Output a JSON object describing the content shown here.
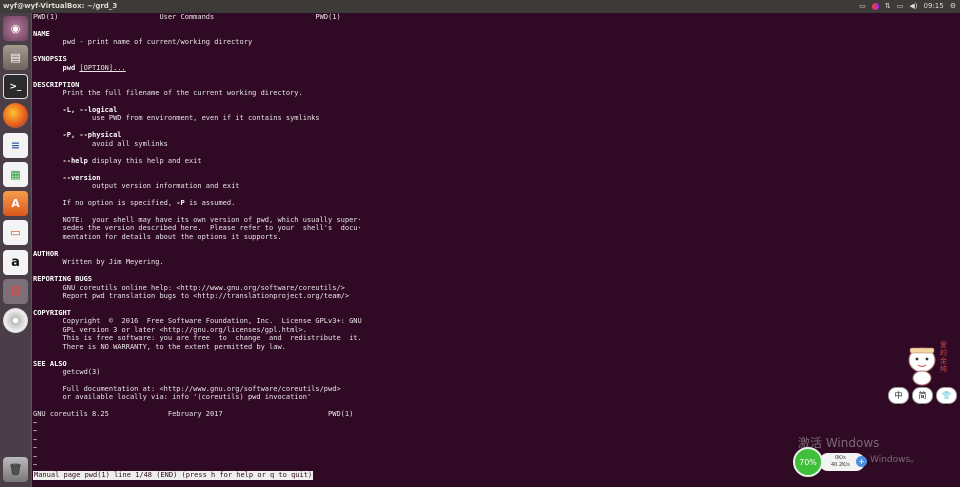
{
  "window": {
    "title": "wyf@wyf-VirtualBox: ~/grd_3"
  },
  "tray": {
    "time": "09:15",
    "icons": [
      "keyboard-icon",
      "color-app-icon",
      "network-icon",
      "battery-icon",
      "volume-icon",
      "gear-icon"
    ]
  },
  "launcher": {
    "items": [
      {
        "name": "ubuntu-dash-icon"
      },
      {
        "name": "file-manager-icon"
      },
      {
        "name": "terminal-icon"
      },
      {
        "name": "firefox-icon"
      },
      {
        "name": "writer-icon"
      },
      {
        "name": "calc-icon"
      },
      {
        "name": "software-center-icon"
      },
      {
        "name": "impress-icon"
      },
      {
        "name": "amazon-icon"
      },
      {
        "name": "settings-icon"
      },
      {
        "name": "disc-icon"
      },
      {
        "name": "trash-icon"
      }
    ]
  },
  "man": {
    "header_left": "PWD(1)",
    "header_center": "User Commands",
    "header_right": "PWD(1)",
    "name_heading": "NAME",
    "name_text": "pwd - print name of current/working directory",
    "synopsis_heading": "SYNOPSIS",
    "synopsis_cmd": "pwd",
    "synopsis_opt": "[OPTION]...",
    "description_heading": "DESCRIPTION",
    "description_text": "Print the full filename of the current working directory.",
    "opt1": "-L, --logical",
    "opt1_desc": "use PWD from environment, even if it contains symlinks",
    "opt2": "-P, --physical",
    "opt2_desc": "avoid all symlinks",
    "opt3": "--help",
    "opt3_desc": "display this help and exit",
    "opt4": "--version",
    "opt4_desc": "output version information and exit",
    "noopt_pre": "If no option is specified, ",
    "noopt_flag": "-P",
    "noopt_post": " is assumed.",
    "note1": "NOTE:  your shell may have its own version of pwd, which usually super·",
    "note2": "sedes the version described here.  Please refer to your  shell's  docu·",
    "note3": "mentation for details about the options it supports.",
    "author_heading": "AUTHOR",
    "author_text": "Written by Jim Meyering.",
    "bugs_heading": "REPORTING BUGS",
    "bugs1": "GNU coreutils online help: <http://www.gnu.org/software/coreutils/>",
    "bugs2": "Report pwd translation bugs to <http://translationproject.org/team/>",
    "copyright_heading": "COPYRIGHT",
    "copy1": "Copyright  ©  2016  Free Software Foundation, Inc.  License GPLv3+: GNU",
    "copy2": "GPL version 3 or later <http://gnu.org/licenses/gpl.html>.",
    "copy3": "This is free software: you are free  to  change  and  redistribute  it.",
    "copy4": "There is NO WARRANTY, to the extent permitted by law.",
    "seealso_heading": "SEE ALSO",
    "seealso1": "getcwd(3)",
    "seealso2": "Full documentation at: <http://www.gnu.org/software/coreutils/pwd>",
    "seealso3": "or available locally via: info '(coreutils) pwd invocation'",
    "footer_left": "GNU coreutils 8.25",
    "footer_center": "February 2017",
    "footer_right": "PWD(1)",
    "tilde": "~"
  },
  "status_line": "Manual page pwd(1) line 1/48 (END) (press h for help or q to quit)",
  "overlay": {
    "watermark_title": "激活 Windows",
    "watermark_sub": "Windows。",
    "net_percent": "70%",
    "net_up": "0K/s",
    "net_down": "40.2K/s",
    "net_plus": "+",
    "ime_kana": "爱的金纯",
    "ime_keys": [
      "中",
      "简",
      "👕"
    ]
  },
  "colors": {
    "terminal_bg": "#300a24",
    "launcher_bg": "#4a3f48",
    "topbar_bg": "#3c3b37"
  }
}
